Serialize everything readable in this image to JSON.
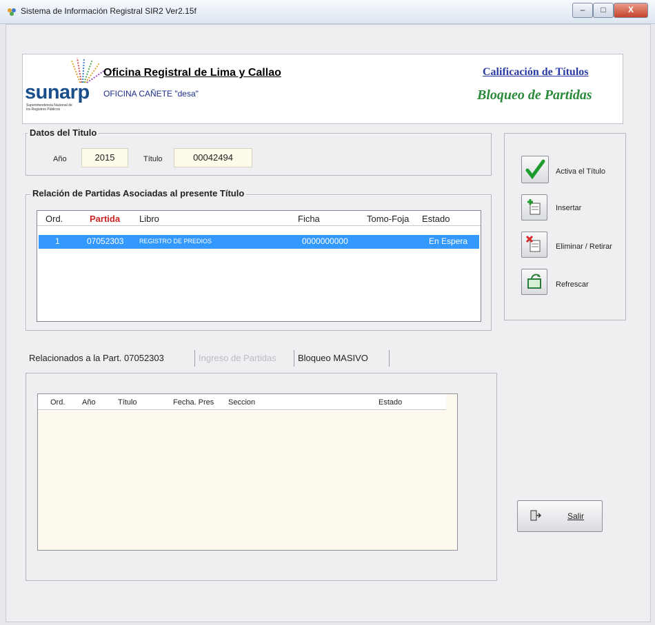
{
  "window": {
    "title": "Sistema de Información Registral SIR2   Ver2.15f",
    "minimize": "–",
    "maximize": "□",
    "close": "X"
  },
  "header": {
    "logo_text": "sunarp",
    "logo_subtitle": "Superintendencia Nacional de los Registros Públicos",
    "office_name": "Oficina Registral de Lima y Callao",
    "office_sub": "OFICINA CAÑETE \"desa\"",
    "module": "Calificación de Títulos",
    "screen": "Bloqueo de Partidas"
  },
  "titulo": {
    "group_title": "Datos del Titulo",
    "year_label": "Año",
    "year": "2015",
    "titulo_label": "Título",
    "titulo_number": "00042494"
  },
  "partidas": {
    "group_title": "Relación de Partidas Asociadas al presente Título",
    "columns": [
      "Ord.",
      "Partida",
      "Libro",
      "Ficha",
      "Tomo-Foja",
      "Estado"
    ],
    "rows": [
      {
        "ord": "1",
        "partida": "07052303",
        "libro": "REGISTRO DE PREDIOS",
        "ficha": "0000000000",
        "tomo_foja": "",
        "estado": "En Espera"
      }
    ]
  },
  "actions": {
    "activa": "Activa el Título",
    "insertar": "Insertar",
    "eliminar": "Eliminar / Retirar",
    "refrescar": "Refrescar"
  },
  "tabs": [
    {
      "label": "Relacionados a la Part. 07052303",
      "state": "active"
    },
    {
      "label": "Ingreso de Partidas",
      "state": "disabled"
    },
    {
      "label": "Bloqueo MASIVO",
      "state": "normal"
    }
  ],
  "related": {
    "columns": [
      "Ord.",
      "Año",
      "Título",
      "Fecha. Pres",
      "Seccion",
      "Estado"
    ]
  },
  "salir": "Salir",
  "colors": {
    "selection": "#3399ff",
    "partida_header": "#cc2222",
    "panel_bg": "#fffaf0",
    "field_bg": "#fffbea"
  }
}
